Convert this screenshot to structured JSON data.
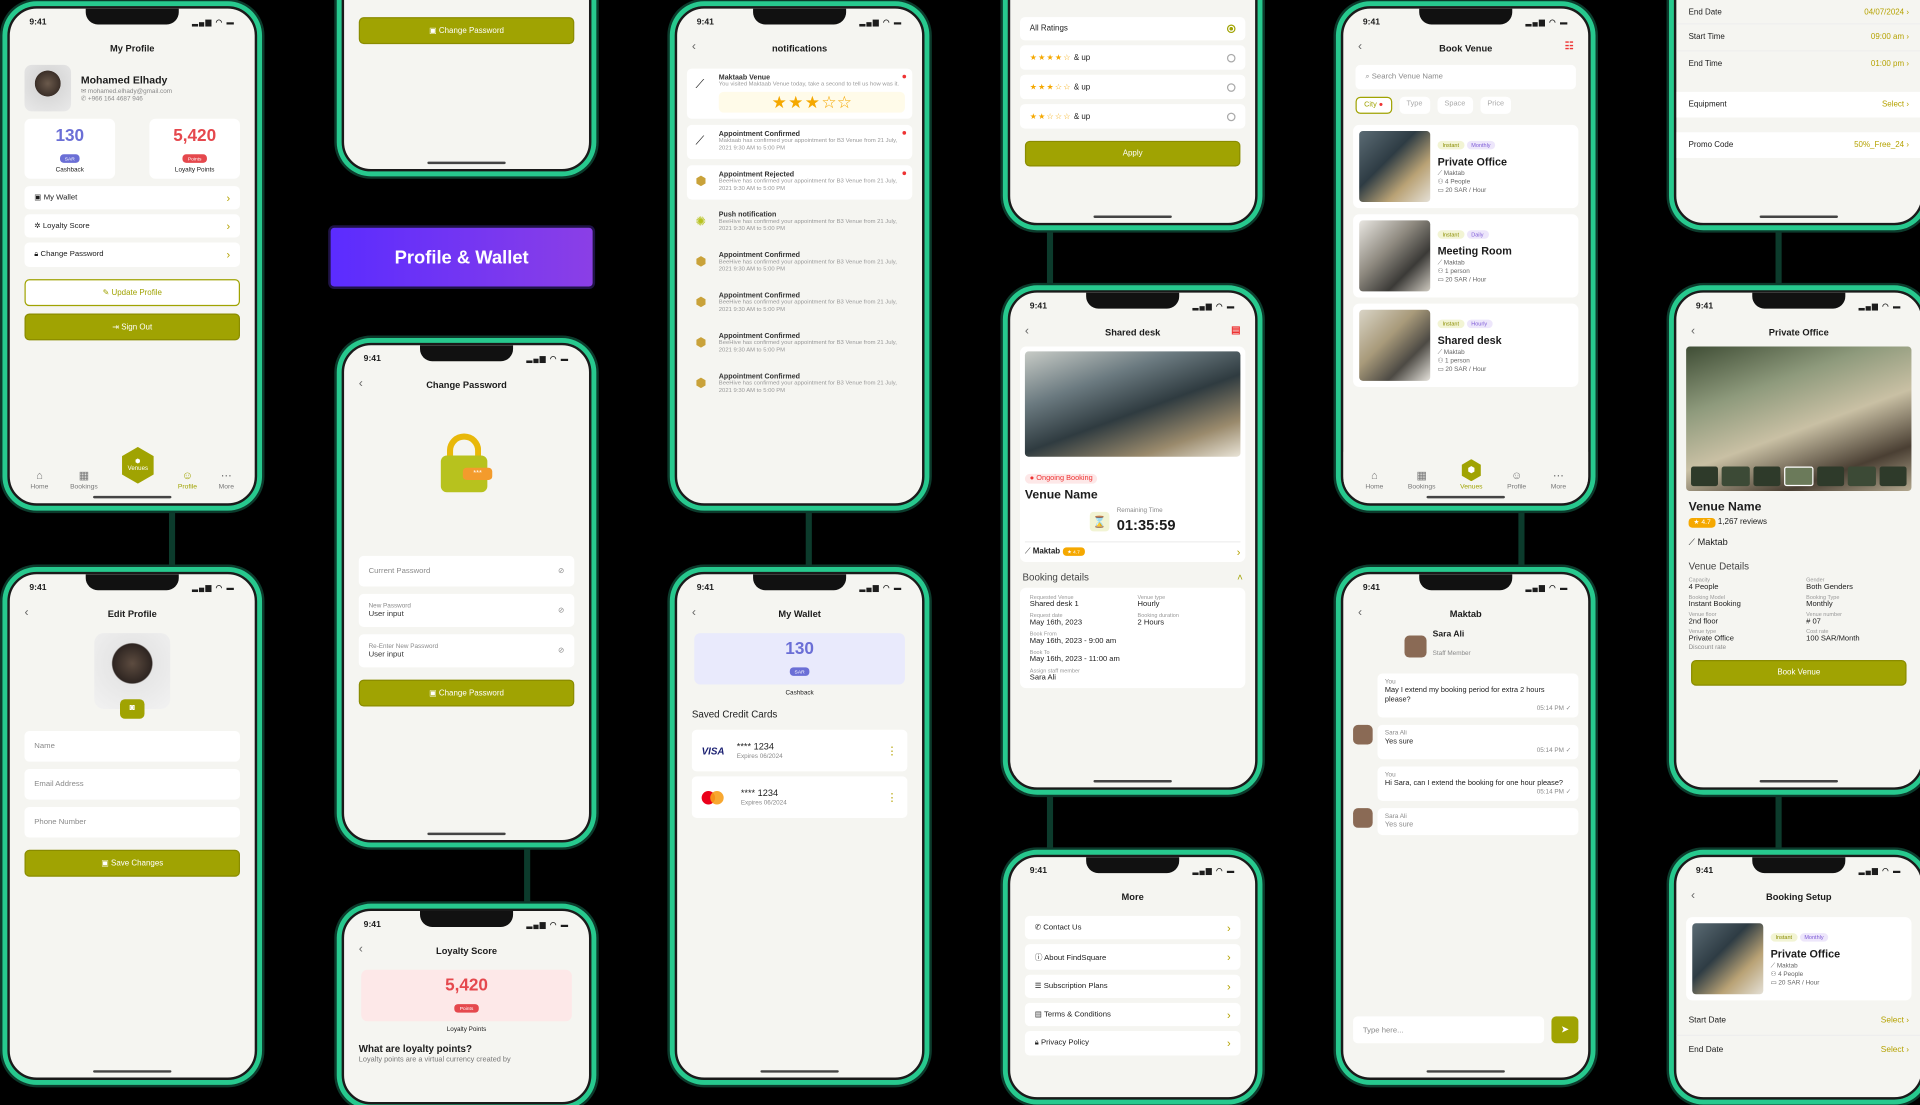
{
  "status_time": "9:41",
  "banner": "Profile & Wallet",
  "profile": {
    "title": "My Profile",
    "name": "Mohamed Elhady",
    "email": "mohamed.elhady@gmail.com",
    "phone": "+966 164 4687 946",
    "cashback_value": "130",
    "cashback_unit": "SAR",
    "cashback_label": "Cashback",
    "loyalty_value": "5,420",
    "loyalty_unit": "Points",
    "loyalty_label": "Loyalty Points",
    "items": [
      "My Wallet",
      "Loyalty Score",
      "Change Password"
    ],
    "update_btn": "Update Profile",
    "signout_btn": "Sign Out"
  },
  "nav": {
    "home": "Home",
    "bookings": "Bookings",
    "venues": "Venues",
    "profile": "Profile",
    "more": "More"
  },
  "edit_profile": {
    "title": "Edit Profile",
    "name_ph": "Name",
    "email_ph": "Email Address",
    "phone_ph": "Phone Number",
    "save_btn": "Save Changes"
  },
  "top_snip": {
    "btn": "Change Password"
  },
  "change_password": {
    "title": "Change Password",
    "current": "Current Password",
    "new_label": "New Password",
    "new_value": "User input",
    "reenter_label": "Re-Enter New Password",
    "reenter_value": "User input",
    "btn": "Change Password"
  },
  "loyalty": {
    "title": "Loyalty Score",
    "value": "5,420",
    "unit": "Points",
    "label": "Loyalty Points",
    "question": "What are loyalty points?",
    "answer": "Loyalty points are a virtual currency created by"
  },
  "notifications": {
    "title": "notifications",
    "items": [
      {
        "title": "Maktaab Venue",
        "body": "You visited Maktaab Venue today, take a second to tell us how was it.",
        "icon": "maktab-logo-icon",
        "dot": true
      },
      {
        "title": "Appointment Confirmed",
        "body": "Maktaab has confirmed your appointment for B3 Venue from 21 July, 2021 9:30 AM to 5:00 PM",
        "icon": "maktab-logo-icon",
        "dot": true
      },
      {
        "title": "Appointment Rejected",
        "body": "BeeHive has confirmed your appointment for B3 Venue from 21 July, 2021 9:30 AM to 5:00 PM",
        "icon": "beehive-logo-icon",
        "dot": true
      },
      {
        "title": "Push notification",
        "body": "BeeHive has confirmed your appointment for B3 Venue from 21 July, 2021 9:30 AM to 5:00 PM",
        "icon": "push-icon",
        "dot": false
      },
      {
        "title": "Appointment Confirmed",
        "body": "BeeHive has confirmed your appointment for B3 Venue from 21 July, 2021 9:30 AM to 5:00 PM",
        "icon": "beehive-logo-icon",
        "dot": false
      },
      {
        "title": "Appointment Confirmed",
        "body": "BeeHive has confirmed your appointment for B3 Venue from 21 July, 2021 9:30 AM to 5:00 PM",
        "icon": "beehive-logo-icon",
        "dot": false
      },
      {
        "title": "Appointment Confirmed",
        "body": "BeeHive has confirmed your appointment for B3 Venue from 21 July, 2021 9:30 AM to 5:00 PM",
        "icon": "beehive-logo-icon",
        "dot": false
      },
      {
        "title": "Appointment Confirmed",
        "body": "BeeHive has confirmed your appointment for B3 Venue from 21 July, 2021 9:30 AM to 5:00 PM",
        "icon": "beehive-logo-icon",
        "dot": false
      }
    ],
    "rating": 3
  },
  "wallet": {
    "title": "My Wallet",
    "cashback_value": "130",
    "cashback_unit": "SAR",
    "cashback_label": "Cashback",
    "saved_title": "Saved Credit Cards",
    "cards": [
      {
        "brand": "VISA",
        "number": "**** 1234",
        "expiry": "Expires 06/2024"
      },
      {
        "brand": "mastercard",
        "number": "**** 1234",
        "expiry": "Expires 06/2024"
      }
    ]
  },
  "filter": {
    "all": "All Ratings",
    "rows": [
      {
        "stars": 4,
        "label": "& up"
      },
      {
        "stars": 3,
        "label": "& up"
      },
      {
        "stars": 2,
        "label": "& up"
      }
    ],
    "apply": "Apply"
  },
  "shared_desk": {
    "title": "Shared desk",
    "status": "Ongoing Booking",
    "venue": "Venue Name",
    "remaining_label": "Remaining Time",
    "remaining": "01:35:59",
    "host": "Maktab",
    "host_rating": "4.7",
    "details_title": "Booking details",
    "details": [
      {
        "k": "Requested Venue",
        "v": "Shared desk 1"
      },
      {
        "k": "Venue type",
        "v": "Hourly"
      },
      {
        "k": "Request date",
        "v": "May 16th, 2023"
      },
      {
        "k": "Booking duration",
        "v": "2 Hours"
      }
    ],
    "book_from_label": "Book From",
    "book_from": "May 16th, 2023 - 9:00 am",
    "book_to_label": "Book To",
    "book_to": "May 16th, 2023 - 11:00 am",
    "staff_label": "Assign staff member",
    "staff": "Sara Ali"
  },
  "more": {
    "title": "More",
    "items": [
      "Contact Us",
      "About FindSquare",
      "Subscription Plans",
      "Terms & Conditions",
      "Privacy Policy"
    ]
  },
  "book_venue": {
    "title": "Book Venue",
    "search_ph": "Search Venue Name",
    "filters": [
      "City",
      "Type",
      "Space",
      "Price"
    ],
    "venues": [
      {
        "tag1": "Instant",
        "tag2": "Monthly",
        "name": "Private Office",
        "host": "Maktab",
        "cap": "4 People",
        "price": "20 SAR / Hour"
      },
      {
        "tag1": "Instant",
        "tag2": "Daily",
        "name": "Meeting Room",
        "host": "Maktab",
        "cap": "1 person",
        "price": "20 SAR / Hour"
      },
      {
        "tag1": "Instant",
        "tag2": "Hourly",
        "name": "Shared desk",
        "host": "Maktab",
        "cap": "1 person",
        "price": "20 SAR / Hour"
      }
    ]
  },
  "chat": {
    "title": "Maktab",
    "staff_name": "Sara Ali",
    "staff_role": "Staff Member",
    "messages": [
      {
        "from": "You",
        "text": "May I extend my booking period for extra 2 hours please?",
        "time": "05:14 PM"
      },
      {
        "from": "Sara Ali",
        "text": "Yes sure",
        "time": "05:14 PM"
      },
      {
        "from": "You",
        "text": "Hi Sara, can I extend the booking for one hour please?",
        "time": "05:14 PM"
      },
      {
        "from": "Sara Ali",
        "text": "Yes sure",
        "time": ""
      }
    ],
    "input_ph": "Type here..."
  },
  "top_right": {
    "end_date_label": "End Date",
    "end_date": "04/07/2024",
    "start_time_label": "Start Time",
    "start_time": "09:00 am",
    "end_time_label": "End Time",
    "end_time": "01:00 pm",
    "equipment_label": "Equipment",
    "equipment": "Select",
    "promo_label": "Promo Code",
    "promo": "50%_Free_24"
  },
  "private_office": {
    "title": "Private Office",
    "venue": "Venue Name",
    "rating": "4.7",
    "reviews": "1,267 reviews",
    "host": "Maktab",
    "details_title": "Venue Details",
    "details": [
      {
        "k": "Capacity",
        "v": "4 People"
      },
      {
        "k": "Gender",
        "v": "Both Genders"
      },
      {
        "k": "Booking Model",
        "v": "Instant Booking"
      },
      {
        "k": "Booking Type",
        "v": "Monthly"
      },
      {
        "k": "Venue floor",
        "v": "2nd floor"
      },
      {
        "k": "Venue number",
        "v": "# 07"
      },
      {
        "k": "Venue type",
        "v": "Private Office"
      },
      {
        "k": "Cost rate",
        "v": "100 SAR/Month"
      }
    ],
    "discount_label": "Discount rate",
    "btn": "Book Venue"
  },
  "booking_setup": {
    "title": "Booking Setup",
    "tag1": "Instant",
    "tag2": "Monthly",
    "name": "Private Office",
    "host": "Maktab",
    "cap": "4 People",
    "price": "20 SAR / Hour",
    "start_label": "Start Date",
    "start": "Select",
    "end_label": "End Date",
    "end": "Select"
  },
  "colors": {
    "accent": "#a0a302",
    "frame": "#27c98e",
    "banner": "#6b33f5"
  }
}
